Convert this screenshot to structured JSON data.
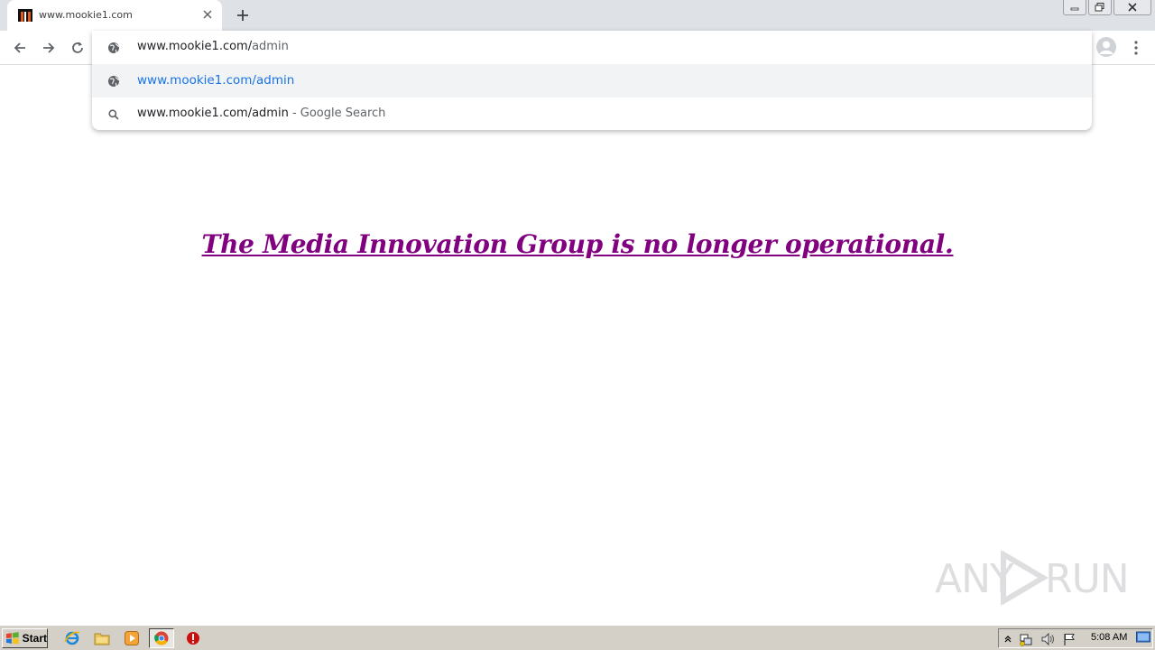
{
  "browser": {
    "tab": {
      "title": "www.mookie1.com",
      "favicon": "mookie-m-logo"
    },
    "window_buttons": [
      "minimize",
      "restore",
      "close"
    ]
  },
  "toolbar": {
    "back": "back-arrow-icon",
    "forward": "forward-arrow-icon",
    "reload": "reload-icon",
    "profile": "avatar-icon",
    "menu": "three-dot-menu-icon"
  },
  "omnibox": {
    "input": {
      "typed": "www.mookie1.com/",
      "completion": "admin"
    },
    "suggestions": [
      {
        "icon": "globe-icon",
        "text": "www.mookie1.com/admin",
        "suffix": ""
      },
      {
        "icon": "search-icon",
        "text": "www.mookie1.com/admin",
        "suffix": " - Google Search"
      }
    ]
  },
  "page": {
    "headline": "The Media Innovation Group is no longer operational."
  },
  "watermark": {
    "text_left": "ANY",
    "text_right": "RUN"
  },
  "taskbar": {
    "start_label": "Start",
    "clock": "5:08 AM"
  },
  "colors": {
    "headline": "#800080",
    "suggestion_link": "#1a73e8",
    "tabstrip": "#dee1e6",
    "taskbar": "#d4d0c8"
  }
}
